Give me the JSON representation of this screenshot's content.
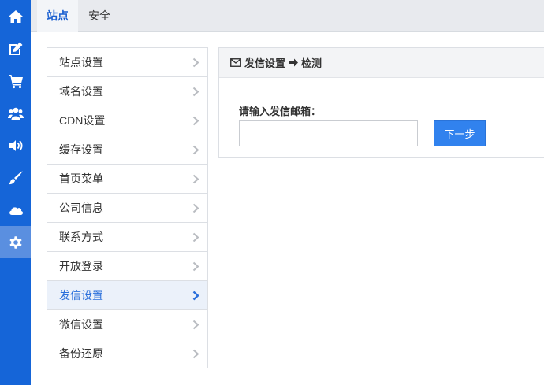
{
  "rail": {
    "items": [
      {
        "icon": "home-icon",
        "active": false
      },
      {
        "icon": "edit-icon",
        "active": false
      },
      {
        "icon": "cart-icon",
        "active": false
      },
      {
        "icon": "users-icon",
        "active": false
      },
      {
        "icon": "volume-icon",
        "active": false
      },
      {
        "icon": "brush-icon",
        "active": false
      },
      {
        "icon": "cloud-icon",
        "active": false
      },
      {
        "icon": "gear-icon",
        "active": true
      }
    ]
  },
  "tabs": [
    {
      "label": "站点",
      "active": true
    },
    {
      "label": "安全",
      "active": false
    }
  ],
  "menu": {
    "items": [
      {
        "label": "站点设置"
      },
      {
        "label": "域名设置"
      },
      {
        "label": "CDN设置"
      },
      {
        "label": "缓存设置"
      },
      {
        "label": "首页菜单"
      },
      {
        "label": "公司信息"
      },
      {
        "label": "联系方式"
      },
      {
        "label": "开放登录"
      },
      {
        "label": "发信设置",
        "active": true
      },
      {
        "label": "微信设置"
      },
      {
        "label": "备份还原"
      }
    ]
  },
  "panel": {
    "title_left": "发信设置",
    "title_right": "检测",
    "field_label": "请输入发信邮箱：",
    "email_value": "",
    "next_label": "下一步"
  },
  "colors": {
    "rail_bg": "#1565d8",
    "rail_active": "#5a8fe0",
    "accent": "#2a6fdb",
    "button": "#3182ee"
  }
}
